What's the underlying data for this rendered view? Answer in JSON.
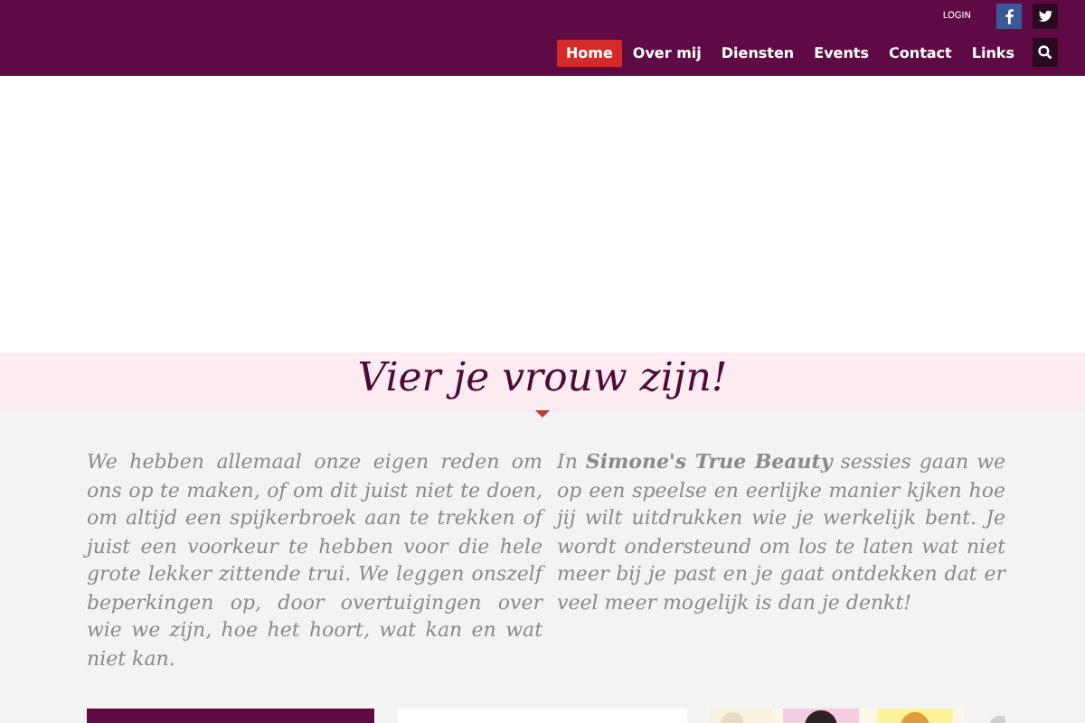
{
  "header": {
    "login": "LOGIN",
    "nav": [
      {
        "label": "Home",
        "selected": true
      },
      {
        "label": "Over mij",
        "selected": false
      },
      {
        "label": "Diensten",
        "selected": false
      },
      {
        "label": "Events",
        "selected": false
      },
      {
        "label": "Contact",
        "selected": false
      },
      {
        "label": "Links",
        "selected": false
      }
    ]
  },
  "banner": {
    "title": "Vier je vrouw zijn!"
  },
  "columns": [
    "We hebben allemaal onze eigen reden om ons op te maken, of om dit juist niet te doen, om altijd een spijkerbroek aan te trekken of juist een voorkeur te hebben voor die hele grote lekker zittende trui. We leggen onszelf beperkingen op, door overtuigingen over wie we zijn, hoe het hoort, wat kan en wat niet kan.",
    "In **Simone's True Beauty** sessies gaan we op een speelse en eerlijke manier kjken hoe jij wilt uitdrukken wie je werkelijk bent. Je wordt ondersteund om los te laten wat niet meer bij je past en je gaat ontdekken dat er veel meer mogelijk is dan je denkt!"
  ],
  "cards": [
    {
      "kind": "plain"
    },
    {
      "kind": "white"
    },
    {
      "kind": "picture"
    }
  ]
}
